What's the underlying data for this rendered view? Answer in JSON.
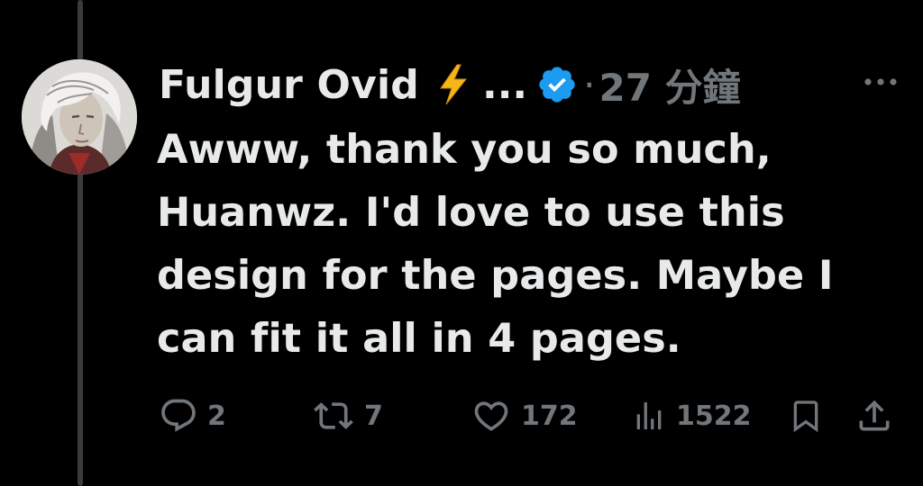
{
  "author": {
    "display_name": "Fulgur Ovid",
    "name_truncation": "...",
    "verified": true
  },
  "meta": {
    "separator": "·",
    "time": "27 分鐘"
  },
  "tweet": {
    "text": "Awww, thank you so much,\nHuanwz. I'd love to use this\ndesign for the pages. Maybe I\ncan fit it all in 4 pages."
  },
  "actions": {
    "replies": "2",
    "reposts": "7",
    "likes": "172",
    "views": "1522"
  },
  "colors": {
    "background": "#000000",
    "text": "#e7e9ea",
    "muted": "#71767b",
    "verified_blue": "#1d9bf0",
    "bolt_yellow": "#f6b617"
  },
  "icons": {
    "bolt": "high-voltage-emoji",
    "verified": "verified-badge-icon",
    "more": "more-horizontal-icon",
    "reply": "reply-icon",
    "repost": "repost-icon",
    "like": "heart-icon",
    "views": "views-icon",
    "bookmark": "bookmark-icon",
    "share": "share-icon"
  }
}
